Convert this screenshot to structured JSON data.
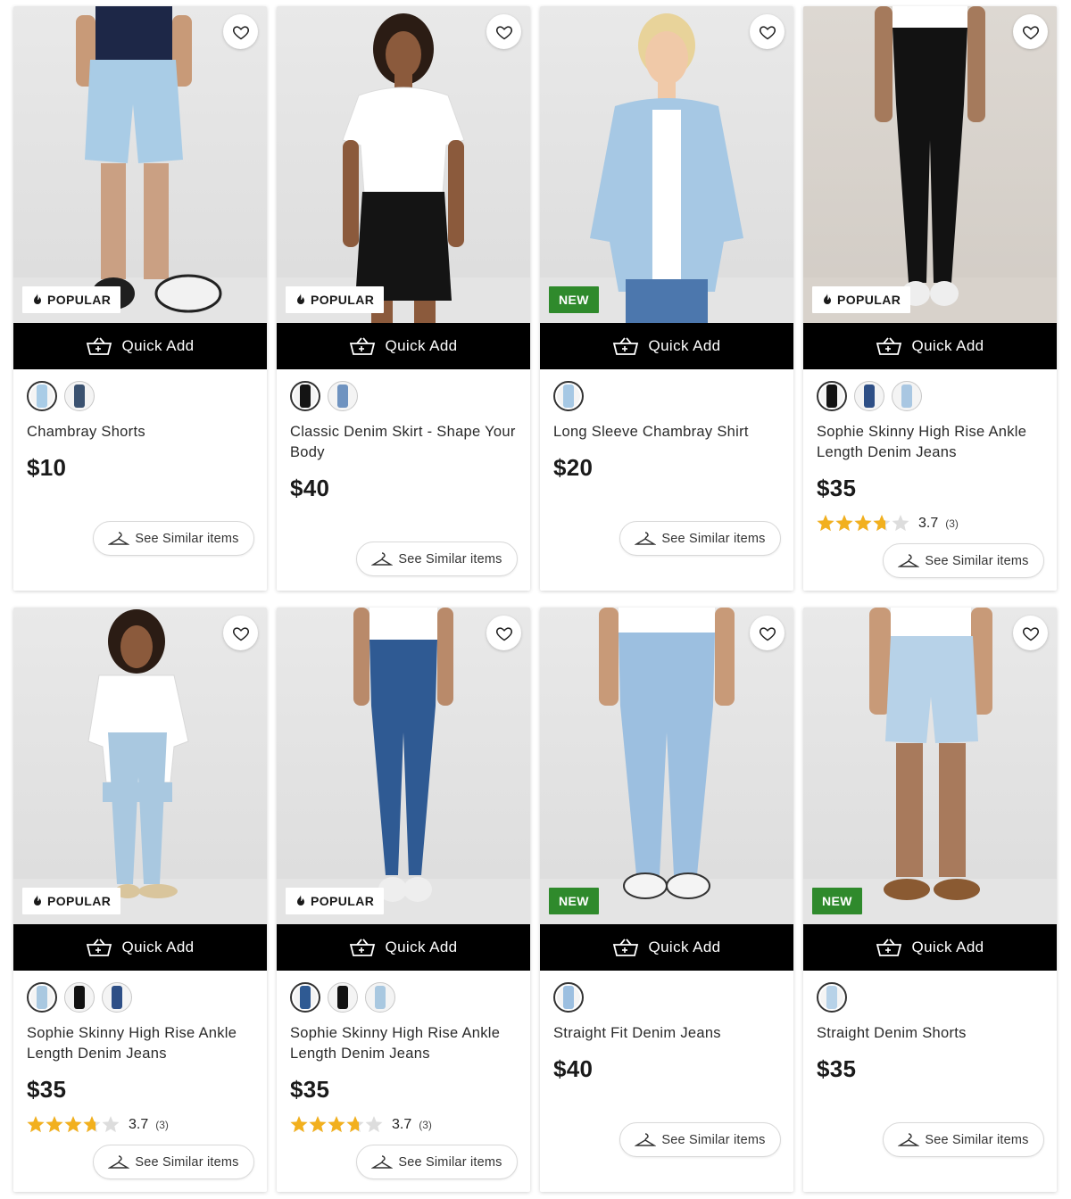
{
  "ui": {
    "quick_add": "Quick Add",
    "see_similar": "See Similar items",
    "popular": "POPULAR",
    "new": "NEW"
  },
  "colors": {
    "new_badge": "#2f8a2c",
    "quick_add_bar": "#000000",
    "star": "#f2b01e"
  },
  "products": [
    {
      "name": "Chambray Shorts",
      "price": "$10",
      "badge": "popular",
      "swatches": 2
    },
    {
      "name": "Classic Denim Skirt - Shape Your Body",
      "price": "$40",
      "badge": "popular",
      "swatches": 2
    },
    {
      "name": "Long Sleeve Chambray Shirt",
      "price": "$20",
      "badge": "new",
      "swatches": 1
    },
    {
      "name": "Sophie Skinny High Rise Ankle Length Denim Jeans",
      "price": "$35",
      "badge": "popular",
      "swatches": 3,
      "rating": "3.7",
      "reviews": "(3)",
      "stars": 3.7
    },
    {
      "name": "Sophie Skinny High Rise Ankle Length Denim Jeans",
      "price": "$35",
      "badge": "popular",
      "swatches": 3,
      "rating": "3.7",
      "reviews": "(3)",
      "stars": 3.7
    },
    {
      "name": "Sophie Skinny High Rise Ankle Length Denim Jeans",
      "price": "$35",
      "badge": "popular",
      "swatches": 3,
      "rating": "3.7",
      "reviews": "(3)",
      "stars": 3.7
    },
    {
      "name": "Straight Fit Denim Jeans",
      "price": "$40",
      "badge": "new",
      "swatches": 1
    },
    {
      "name": "Straight Denim Shorts",
      "price": "$35",
      "badge": "new",
      "swatches": 1
    }
  ]
}
